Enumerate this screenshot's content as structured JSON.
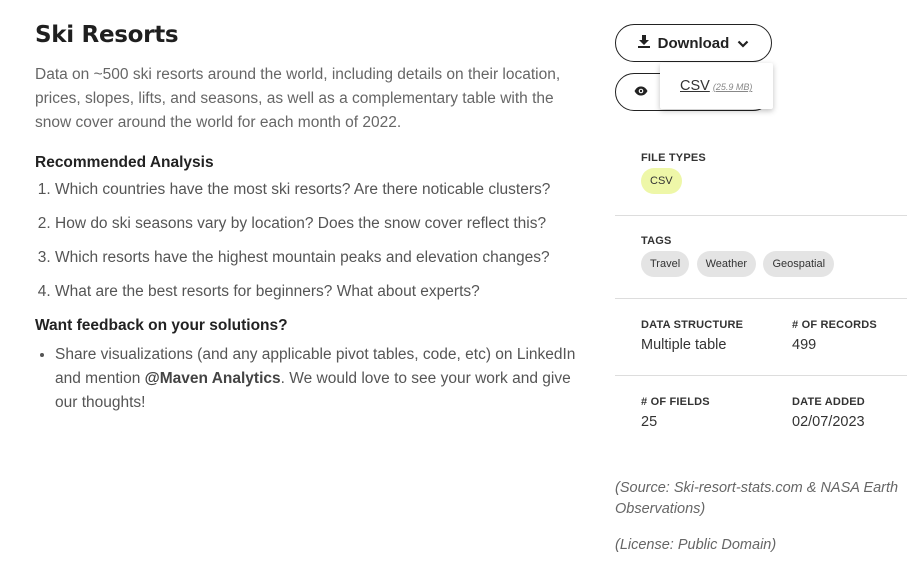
{
  "title": "Ski Resorts",
  "description": "Data on ~500 ski resorts around the world, including details on their location, prices, slopes, lifts, and seasons, as well as a complementary table with the snow cover around the world for each month of 2022.",
  "recommended": {
    "heading": "Recommended Analysis",
    "items": [
      "Which countries have the most ski resorts? Are there noticable clusters?",
      "How do ski seasons vary by location? Does the snow cover reflect this?",
      "Which resorts have the highest mountain peaks and elevation changes?",
      "What are the best resorts for beginners? What about experts?"
    ]
  },
  "feedback": {
    "heading": "Want feedback on your solutions?",
    "text_before": "Share visualizations (and any applicable pivot tables, code, etc) on LinkedIn and mention ",
    "mention": "@Maven Analytics",
    "text_after": ". We would love to see your work and give our thoughts!"
  },
  "actions": {
    "download_label": "Download",
    "download_icon": "download-icon",
    "preview_icon": "eye-icon",
    "dropdown": {
      "option_label": "CSV",
      "option_size": "(25.9 MB)"
    }
  },
  "file_types": {
    "label": "FILE TYPES",
    "items": [
      "CSV"
    ]
  },
  "tags": {
    "label": "TAGS",
    "items": [
      "Travel",
      "Weather",
      "Geospatial"
    ]
  },
  "data_structure": {
    "label": "DATA STRUCTURE",
    "value": "Multiple table"
  },
  "records": {
    "label": "# OF RECORDS",
    "value": "499"
  },
  "fields": {
    "label": "# OF FIELDS",
    "value": "25"
  },
  "date_added": {
    "label": "DATE ADDED",
    "value": "02/07/2023"
  },
  "source": "(Source: Ski-resort-stats.com & NASA Earth Observations)",
  "license": "(License: Public Domain)",
  "colors": {
    "file_type_pill": "#eef7a8",
    "tag_pill": "#e4e4e4"
  }
}
